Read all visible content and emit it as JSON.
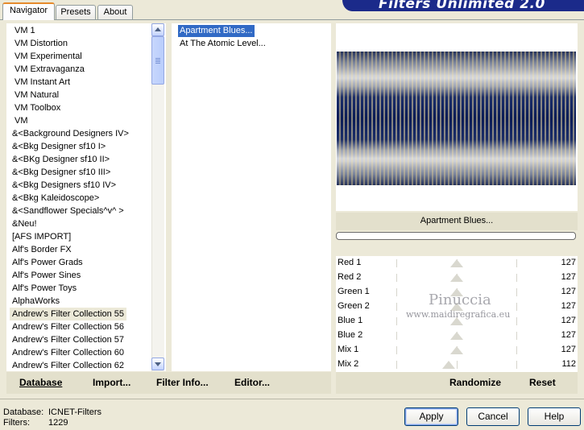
{
  "tabs": [
    {
      "label": "Navigator",
      "active": true
    },
    {
      "label": "Presets",
      "active": false
    },
    {
      "label": "About",
      "active": false
    }
  ],
  "banner_title": "Filters Unlimited 2.0",
  "categories": [
    "VM 1",
    "VM Distortion",
    "VM Experimental",
    "VM Extravaganza",
    "VM Instant Art",
    "VM Natural",
    "VM Toolbox",
    "VM",
    "&<Background Designers IV>",
    "&<Bkg Designer sf10 I>",
    "&<BKg Designer sf10 II>",
    "&<Bkg Designer sf10 III>",
    "&<Bkg Designers sf10 IV>",
    "&<Bkg Kaleidoscope>",
    "&<Sandflower Specials^v^ >",
    "&Neu!",
    "[AFS IMPORT]",
    "Alf's Border FX",
    "Alf's Power Grads",
    "Alf's Power Sines",
    "Alf's Power Toys",
    "AlphaWorks",
    "Andrew's Filter Collection 55",
    "Andrew's Filter Collection 56",
    "Andrew's Filter Collection 57",
    "Andrew's Filter Collection 60",
    "Andrew's Filter Collection 62"
  ],
  "selected_category": "Andrew's Filter Collection 55",
  "filters": [
    "Apartment Blues...",
    "At The Atomic Level..."
  ],
  "selected_filter": "Apartment Blues...",
  "preview_label": "Apartment Blues...",
  "sliders": [
    {
      "label": "Red 1",
      "value": 127
    },
    {
      "label": "Red 2",
      "value": 127
    },
    {
      "label": "Green 1",
      "value": 127
    },
    {
      "label": "Green 2",
      "value": 127
    },
    {
      "label": "Blue 1",
      "value": 127
    },
    {
      "label": "Blue 2",
      "value": 127
    },
    {
      "label": "Mix 1",
      "value": 127
    },
    {
      "label": "Mix 2",
      "value": 112
    }
  ],
  "toolbar": {
    "database": "Database",
    "import": "Import...",
    "filter_info": "Filter Info...",
    "editor": "Editor...",
    "randomize": "Randomize",
    "reset": "Reset"
  },
  "status": {
    "database_label": "Database:",
    "database_value": "ICNET-Filters",
    "filters_label": "Filters:",
    "filters_value": "1229"
  },
  "buttons": {
    "apply": "Apply",
    "cancel": "Cancel",
    "help": "Help"
  },
  "watermark": {
    "name": "Pinuccia",
    "url": "www.maidiregrafica.eu"
  },
  "colors": {
    "selection": "#316ac5",
    "banner": "#1b2a8a",
    "window_bg": "#ece9d8"
  }
}
